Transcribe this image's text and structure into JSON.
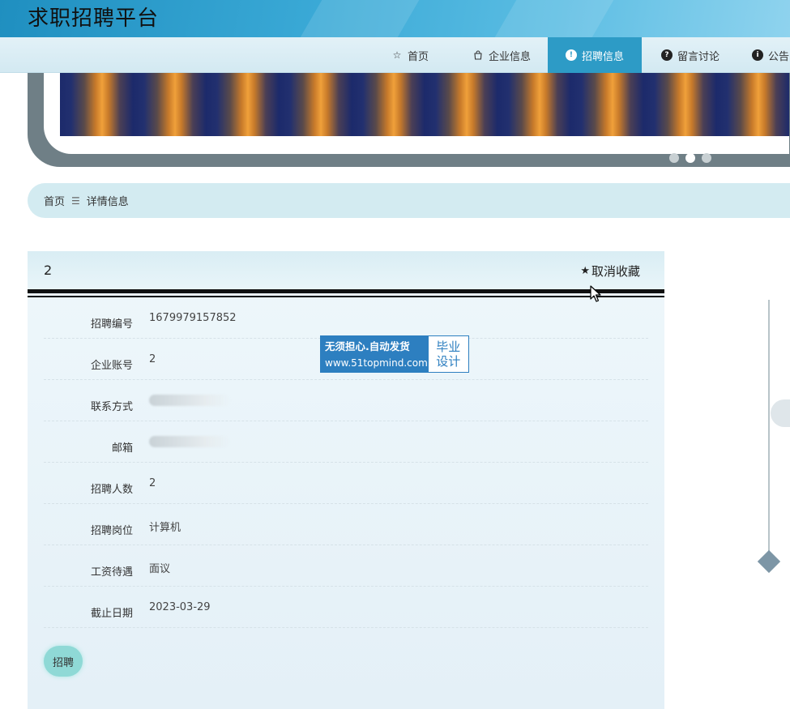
{
  "site": {
    "title": "求职招聘平台"
  },
  "nav": [
    {
      "label": "首页",
      "icon": "star-outline-icon",
      "active": false
    },
    {
      "label": "企业信息",
      "icon": "shopping-bag-icon",
      "active": false
    },
    {
      "label": "招聘信息",
      "icon": "exclamation-circle-icon",
      "active": true
    },
    {
      "label": "留言讨论",
      "icon": "question-circle-icon",
      "active": false
    },
    {
      "label": "公告",
      "icon": "info-circle-icon",
      "active": false
    }
  ],
  "breadcrumb": {
    "home": "首页",
    "current": "详情信息"
  },
  "detail": {
    "title": "2",
    "favorite_label": "取消收藏",
    "fields": [
      {
        "label": "招聘编号",
        "value": "1679979157852"
      },
      {
        "label": "企业账号",
        "value": "2"
      },
      {
        "label": "联系方式",
        "value": ""
      },
      {
        "label": "邮箱",
        "value": ""
      },
      {
        "label": "招聘人数",
        "value": "2"
      },
      {
        "label": "招聘岗位",
        "value": "计算机"
      },
      {
        "label": "工资待遇",
        "value": "面议"
      },
      {
        "label": "截止日期",
        "value": "2023-03-29"
      }
    ],
    "apply_label": "招聘"
  },
  "watermark": {
    "slogan": "无须担心.自动发货",
    "url": "www.51topmind.com",
    "tag_line1": "毕业",
    "tag_line2": "设计"
  },
  "colors": {
    "accent": "#2d9bc6",
    "panel": "#eef7fb",
    "apply": "#8fd9d6"
  }
}
